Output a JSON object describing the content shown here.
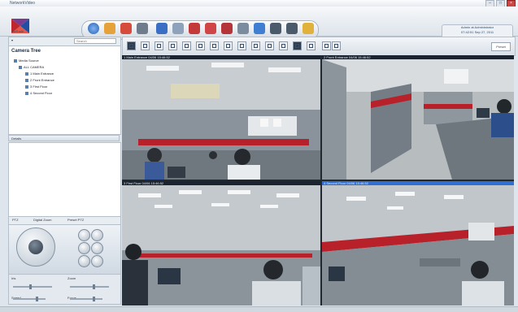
{
  "app": {
    "title": "NetworkVideo"
  },
  "toolbar": {
    "icons": [
      "live-view-icon",
      "playback-icon",
      "search-icon",
      "settings-icon",
      "layout-icon",
      "camera-icon",
      "record-icon",
      "alarm-icon",
      "disconnect-icon",
      "sequence-icon",
      "export-icon",
      "user-icon",
      "users-icon",
      "help-icon"
    ]
  },
  "info_box": {
    "line1": "Admin at Administrator",
    "line2": "07:42:51 Sep 27, 2011"
  },
  "logo_label": "BizRade",
  "search_placeholder": "Search",
  "tree": {
    "title": "Camera Tree",
    "items": [
      {
        "label": "Media Source"
      },
      {
        "label": "ALL CAMERA"
      },
      {
        "label": "1 Main Entrance"
      },
      {
        "label": "2 Front Entrance"
      },
      {
        "label": "3 First Floor"
      },
      {
        "label": "4 Second Floor"
      }
    ]
  },
  "details_label": "Details",
  "ptz": {
    "tab1": "PTZ",
    "tab2": "Digital Zoom",
    "tab3": "Preset PTZ"
  },
  "sliders": {
    "s1": "Iris",
    "s2": "Zoom",
    "s3": "Speed",
    "s4": "Focus"
  },
  "quick_label": "Preset",
  "cameras": [
    {
      "title": "1 Main Entrance   04/06 15:46:52"
    },
    {
      "title": "2 Front Entrance   04/06 15:46:52"
    },
    {
      "title": "3 First Floor   04/06 15:46:52"
    },
    {
      "title": "4 Second Floor   04/06 15:46:52"
    }
  ],
  "colors": {
    "accent": "#2f6fd4",
    "cubicle_red": "#b8202a",
    "topbar": "#e8edf2"
  }
}
